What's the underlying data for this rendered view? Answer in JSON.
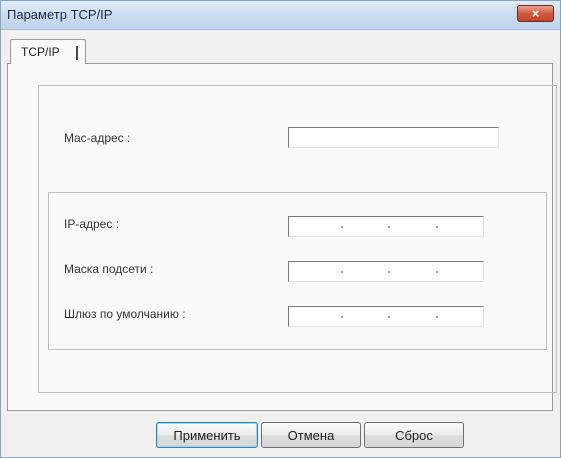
{
  "window": {
    "title": "Параметр TCP/IP",
    "close_icon": "close-icon",
    "close_glyph": "×"
  },
  "tabs": [
    {
      "label": "TCP/IP",
      "selected": true
    }
  ],
  "mac": {
    "label": "Mac-адрес :",
    "value": ""
  },
  "ip_fields": [
    {
      "label": "IP-адрес :",
      "value": ""
    },
    {
      "label": "Маска подсети :",
      "value": ""
    },
    {
      "label": "Шлюз по умолчанию :",
      "value": ""
    }
  ],
  "buttons": {
    "apply": "Применить",
    "cancel": "Отмена",
    "reset": "Сброс"
  },
  "colors": {
    "close_button": "#c94a2f",
    "title_bar": "#c9daee"
  }
}
